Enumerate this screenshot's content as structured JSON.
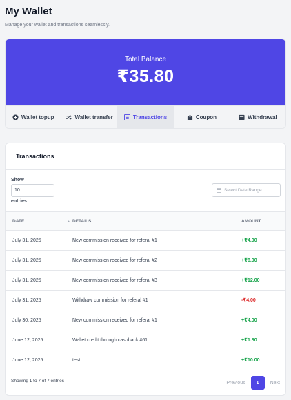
{
  "page": {
    "title": "My Wallet",
    "subtitle": "Manage your wallet and transactions seamlessly."
  },
  "balance": {
    "label": "Total Balance",
    "amount": "₹35.80"
  },
  "tabs": [
    {
      "label": "Wallet topup",
      "icon": "plus-circle-icon"
    },
    {
      "label": "Wallet transfer",
      "icon": "shuffle-icon"
    },
    {
      "label": "Transactions",
      "icon": "list-icon",
      "active": true
    },
    {
      "label": "Coupon",
      "icon": "ticket-icon"
    },
    {
      "label": "Withdrawal",
      "icon": "withdraw-icon"
    }
  ],
  "transactions": {
    "title": "Transactions",
    "show_label": "Show",
    "entries_value": "10",
    "entries_label": "entries",
    "date_range_placeholder": "Select Date Range",
    "columns": [
      "DATE",
      "DETAILS",
      "AMOUNT"
    ],
    "rows": [
      {
        "date": "July 31, 2025",
        "details": "New commission received for referal #1",
        "amount": "+₹4.00",
        "type": "credit"
      },
      {
        "date": "July 31, 2025",
        "details": "New commission received for referal #2",
        "amount": "+₹8.00",
        "type": "credit"
      },
      {
        "date": "July 31, 2025",
        "details": "New commission received for referal #3",
        "amount": "+₹12.00",
        "type": "credit"
      },
      {
        "date": "July 31, 2025",
        "details": "Withdraw commission for referal #1",
        "amount": "-₹4.00",
        "type": "debit"
      },
      {
        "date": "July 30, 2025",
        "details": "New commission received for referal #1",
        "amount": "+₹4.00",
        "type": "credit"
      },
      {
        "date": "June 12, 2025",
        "details": "Wallet credit through cashback #61",
        "amount": "+₹1.80",
        "type": "credit"
      },
      {
        "date": "June 12, 2025",
        "details": "test",
        "amount": "+₹10.00",
        "type": "credit"
      }
    ],
    "footer_info": "Showing 1 to 7 of 7 entries",
    "pagination": {
      "previous": "Previous",
      "current": "1",
      "next": "Next"
    }
  },
  "colors": {
    "accent": "#4f46e5",
    "credit": "#16a34a",
    "debit": "#dc2626"
  }
}
